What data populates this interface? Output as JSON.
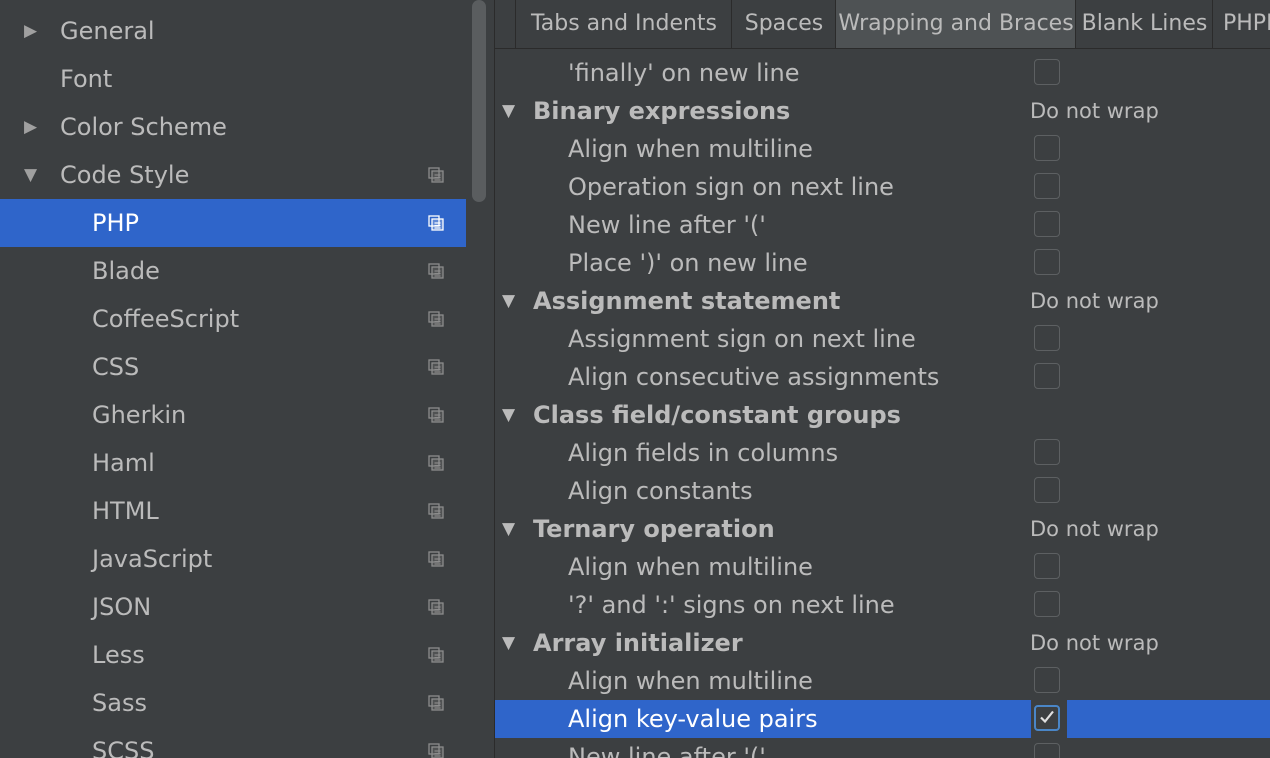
{
  "sidebar": {
    "items": [
      {
        "label": "General",
        "arrow": "▶",
        "level": "top",
        "copy": false,
        "selected": false
      },
      {
        "label": "Font",
        "arrow": "",
        "level": "top",
        "copy": false,
        "selected": false
      },
      {
        "label": "Color Scheme",
        "arrow": "▶",
        "level": "top",
        "copy": false,
        "selected": false
      },
      {
        "label": "Code Style",
        "arrow": "▼",
        "level": "top",
        "copy": true,
        "selected": false
      },
      {
        "label": "PHP",
        "arrow": "",
        "level": "child",
        "copy": true,
        "selected": true
      },
      {
        "label": "Blade",
        "arrow": "",
        "level": "child",
        "copy": true,
        "selected": false
      },
      {
        "label": "CoffeeScript",
        "arrow": "",
        "level": "child",
        "copy": true,
        "selected": false
      },
      {
        "label": "CSS",
        "arrow": "",
        "level": "child",
        "copy": true,
        "selected": false
      },
      {
        "label": "Gherkin",
        "arrow": "",
        "level": "child",
        "copy": true,
        "selected": false
      },
      {
        "label": "Haml",
        "arrow": "",
        "level": "child",
        "copy": true,
        "selected": false
      },
      {
        "label": "HTML",
        "arrow": "",
        "level": "child",
        "copy": true,
        "selected": false
      },
      {
        "label": "JavaScript",
        "arrow": "",
        "level": "child",
        "copy": true,
        "selected": false
      },
      {
        "label": "JSON",
        "arrow": "",
        "level": "child",
        "copy": true,
        "selected": false
      },
      {
        "label": "Less",
        "arrow": "",
        "level": "child",
        "copy": true,
        "selected": false
      },
      {
        "label": "Sass",
        "arrow": "",
        "level": "child",
        "copy": true,
        "selected": false
      },
      {
        "label": "SCSS",
        "arrow": "",
        "level": "child",
        "copy": true,
        "selected": false
      }
    ]
  },
  "tabs": [
    {
      "label": "Tabs and Indents",
      "active": false
    },
    {
      "label": "Spaces",
      "active": false
    },
    {
      "label": "Wrapping and Braces",
      "active": true
    },
    {
      "label": "Blank Lines",
      "active": false
    },
    {
      "label": "PHPDoc",
      "active": false
    }
  ],
  "rows": [
    {
      "type": "item",
      "label": "'finally' on new line",
      "checked": false,
      "selected": false
    },
    {
      "type": "header",
      "label": "Binary expressions",
      "value": "Do not wrap"
    },
    {
      "type": "item",
      "label": "Align when multiline",
      "checked": false,
      "selected": false
    },
    {
      "type": "item",
      "label": "Operation sign on next line",
      "checked": false,
      "selected": false
    },
    {
      "type": "item",
      "label": "New line after '('",
      "checked": false,
      "selected": false
    },
    {
      "type": "item",
      "label": "Place ')' on new line",
      "checked": false,
      "selected": false
    },
    {
      "type": "header",
      "label": "Assignment statement",
      "value": "Do not wrap"
    },
    {
      "type": "item",
      "label": "Assignment sign on next line",
      "checked": false,
      "selected": false
    },
    {
      "type": "item",
      "label": "Align consecutive assignments",
      "checked": false,
      "selected": false
    },
    {
      "type": "header",
      "label": "Class field/constant groups",
      "value": ""
    },
    {
      "type": "item",
      "label": "Align fields in columns",
      "checked": false,
      "selected": false
    },
    {
      "type": "item",
      "label": "Align constants",
      "checked": false,
      "selected": false
    },
    {
      "type": "header",
      "label": "Ternary operation",
      "value": "Do not wrap"
    },
    {
      "type": "item",
      "label": "Align when multiline",
      "checked": false,
      "selected": false
    },
    {
      "type": "item",
      "label": "'?' and ':' signs on next line",
      "checked": false,
      "selected": false
    },
    {
      "type": "header",
      "label": "Array initializer",
      "value": "Do not wrap"
    },
    {
      "type": "item",
      "label": "Align when multiline",
      "checked": false,
      "selected": false
    },
    {
      "type": "item",
      "label": "Align key-value pairs",
      "checked": true,
      "selected": true
    },
    {
      "type": "item",
      "label": "New line after '('",
      "checked": false,
      "selected": false
    }
  ],
  "colors": {
    "selection": "#2f65ca",
    "background": "#3c3f41",
    "text": "#bbbbbb"
  }
}
